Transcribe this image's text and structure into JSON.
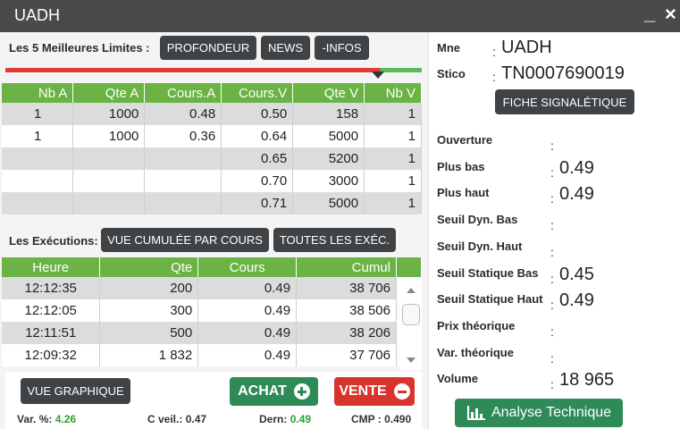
{
  "window": {
    "title": "UADH",
    "minimize": "_",
    "close": "×"
  },
  "best_limits": {
    "label": "Les 5 Meilleures Limites :",
    "buttons": [
      "PROFONDEUR",
      "NEWS",
      "-INFOS"
    ],
    "columns": [
      "Nb A",
      "Qte A",
      "Cours.A",
      "Cours.V",
      "Qte V",
      "Nb V"
    ],
    "rows": [
      [
        "1",
        "1000",
        "0.48",
        "0.50",
        "158",
        "1"
      ],
      [
        "1",
        "1000",
        "0.36",
        "0.64",
        "5000",
        "1"
      ],
      [
        "",
        "",
        "",
        "0.65",
        "5200",
        "1"
      ],
      [
        "",
        "",
        "",
        "0.70",
        "3000",
        "1"
      ],
      [
        "",
        "",
        "",
        "0.71",
        "5000",
        "1"
      ]
    ]
  },
  "executions": {
    "label": "Les Exécutions:",
    "buttons": [
      "VUE CUMULÉE PAR COURS",
      "TOUTES LES EXÉC."
    ],
    "columns": [
      "Heure",
      "Qte",
      "Cours",
      "Cumul"
    ],
    "rows": [
      [
        "12:12:35",
        "200",
        "0.49",
        "38 706"
      ],
      [
        "12:12:05",
        "300",
        "0.49",
        "38 506"
      ],
      [
        "12:11:51",
        "500",
        "0.49",
        "38 206"
      ],
      [
        "12:09:32",
        "1 832",
        "0.49",
        "37 706"
      ]
    ]
  },
  "actions": {
    "graph": "VUE GRAPHIQUE",
    "buy": "ACHAT",
    "sell": "VENTE"
  },
  "stats": [
    {
      "label": "Var. %:",
      "value": "4.26",
      "color": "#2e9e2e"
    },
    {
      "label": "C veil.:",
      "value": "0.47",
      "color": "#222222"
    },
    {
      "label": "Dern:",
      "value": "0.49",
      "color": "#2e9e2e"
    },
    {
      "label": "CMP :",
      "value": "0.490",
      "color": "#222222"
    }
  ],
  "info": {
    "mne_label": "Mne",
    "mne_value": "UADH",
    "stico_label": "Stico",
    "stico_value": "TN0007690019",
    "fiche_button": "FICHE SIGNALÉTIQUE",
    "fields": [
      {
        "label": "Ouverture",
        "value": ""
      },
      {
        "label": "Plus bas",
        "value": "0.49"
      },
      {
        "label": "Plus haut",
        "value": "0.49"
      },
      {
        "label": "Seuil Dyn. Bas",
        "value": ""
      },
      {
        "label": "Seuil Dyn. Haut",
        "value": ""
      },
      {
        "label": "Seuil Statique Bas",
        "value": "0.45"
      },
      {
        "label": "Seuil Statique Haut",
        "value": "0.49"
      },
      {
        "label": "Prix théorique",
        "value": ""
      },
      {
        "label": "Var. théorique",
        "value": ""
      },
      {
        "label": "Volume",
        "value": "18 965"
      }
    ],
    "analyse_button": "Analyse Technique"
  },
  "colors": {
    "accent_green": "#6ab344",
    "buy": "#2e8b57",
    "sell": "#d9342b",
    "dark_button": "#3f4346",
    "titlebar": "#4a4a4a"
  },
  "icons": {
    "buy": "plus-circle-icon",
    "sell": "minus-circle-icon",
    "analyse": "bar-chart-icon"
  }
}
